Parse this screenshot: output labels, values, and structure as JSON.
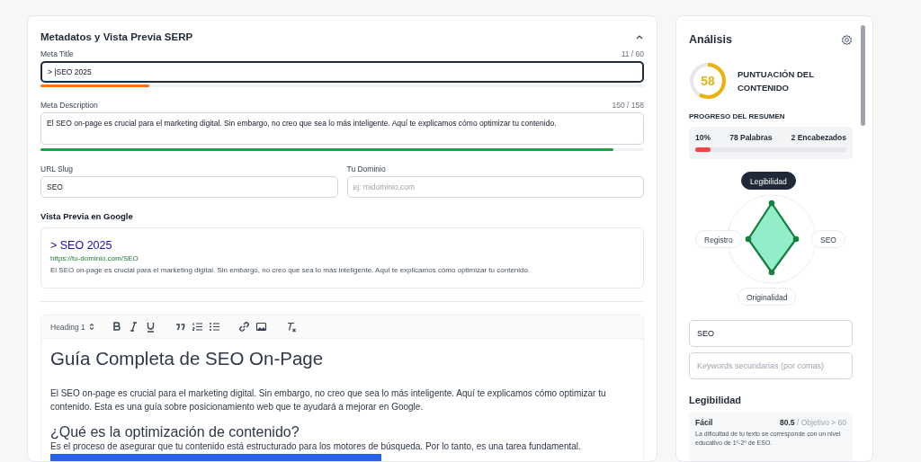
{
  "metadata_panel": {
    "title": "Metadatos y Vista Previa SERP",
    "expanded": true,
    "meta_title": {
      "label": "Meta Title",
      "count": "11 / 60",
      "value": "> |SEO 2025",
      "focused": true,
      "level": 0.18
    },
    "meta_description": {
      "label": "Meta Description",
      "count": "150 / 158",
      "value": "El SEO on-page es crucial para el marketing digital. Sin embargo, no creo que sea lo más inteligente. Aquí te explicamos cómo optimizar tu contenido.",
      "level": 0.95
    },
    "url_slug": {
      "label": "URL Slug",
      "value": "SEO"
    },
    "domain": {
      "label": "Tu Dominio",
      "placeholder": "ej: midominio.com"
    },
    "preview": {
      "label": "Vista Previa en Google",
      "title": "> SEO 2025",
      "url": "https://tu-dominio.com/SEO",
      "description": "El SEO on-page es crucial para el marketing digital. Sin embargo, no creo que sea lo más inteligente. Aquí te explicamos cómo optimizar tu contenido."
    }
  },
  "editor": {
    "toolbar": {
      "heading_select": "Heading 1",
      "tools": [
        {
          "kind": "bold"
        },
        {
          "kind": "italic"
        },
        {
          "kind": "underline"
        },
        {
          "kind": "quote"
        },
        {
          "kind": "ordered-list"
        },
        {
          "kind": "bullet-list"
        },
        {
          "kind": "link"
        },
        {
          "kind": "image"
        },
        {
          "kind": "clear-format"
        }
      ]
    },
    "blocks": [
      {
        "kind": "h1",
        "text": "Guía Completa de SEO On-Page"
      },
      {
        "kind": "p",
        "text": "El SEO on-page es crucial para el marketing digital. Sin embargo, no creo que sea lo más inteligente. Aquí te explicamos cómo optimizar tu contenido. Esta es una guía sobre posicionamiento web que te ayudará a mejorar en Google."
      },
      {
        "kind": "h2",
        "text": "¿Qué es la optimización de contenido?"
      },
      {
        "kind": "p",
        "text": "Es el proceso de asegurar que tu contenido está estructurado para los motores de búsqueda. Por lo tanto, es una tarea fundamental."
      },
      {
        "kind": "block"
      }
    ]
  },
  "analysis": {
    "title": "Análisis",
    "score": {
      "value": "58",
      "label": "PUNTUACIÓN DEL CONTENIDO",
      "level": 0.58
    },
    "summary": {
      "title": "PROGRESO DEL RESUMEN",
      "percent": "10%",
      "words": "78 Palabras",
      "headings": "2 Encabezados",
      "level": 0.1
    },
    "radar_axes": [
      {
        "label": "Legibilidad",
        "selected": true
      },
      {
        "label": "SEO",
        "selected": false
      },
      {
        "label": "Originalidad",
        "selected": false
      },
      {
        "label": "Registro",
        "selected": false
      }
    ],
    "keyword": {
      "value": "SEO"
    },
    "secondary_keywords": {
      "placeholder": "Keywords secundarias (por comas)"
    },
    "readability": {
      "title": "Legibilidad",
      "grade": "Fácil",
      "score": "80.5",
      "target": "/ Objetivo > 60",
      "note": "La dificultad de tu texto se corresponde con un nivel educativo de 1º-2º de ESO."
    }
  }
}
